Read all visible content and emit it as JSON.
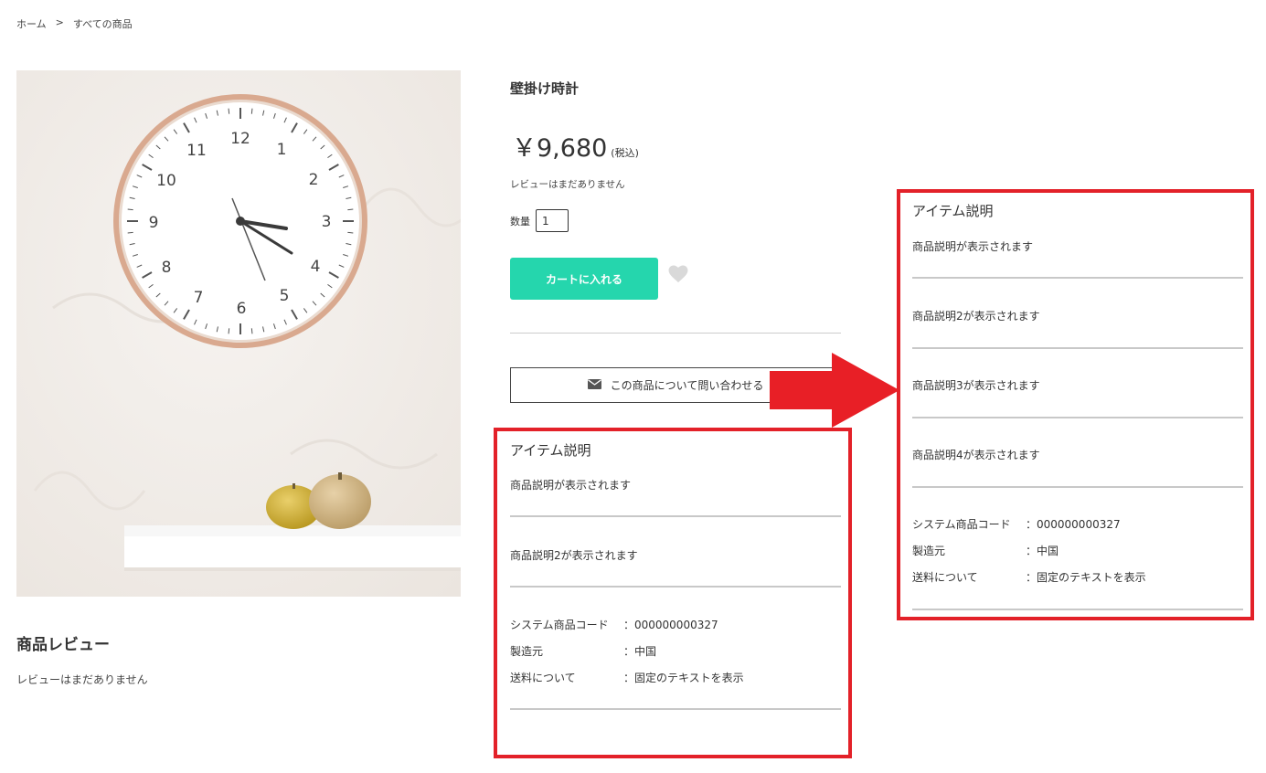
{
  "breadcrumb": {
    "home": "ホーム",
    "separator": ">",
    "current": "すべての商品"
  },
  "product": {
    "title": "壁掛け時計",
    "price": "￥9,680",
    "tax": "(税込)",
    "review_empty": "レビューはまだありません",
    "qty_label": "数量",
    "qty_value": "1",
    "cart_button": "カートに入れる",
    "inquiry_button": "この商品について問い合わせる"
  },
  "reviews": {
    "heading": "商品レビュー",
    "empty": "レビューはまだありません"
  },
  "panel_left": {
    "heading": "アイテム説明",
    "descriptions": [
      "商品説明が表示されます",
      "商品説明2が表示されます"
    ],
    "specs": [
      {
        "key": "システム商品コード",
        "value": "：000000000327"
      },
      {
        "key": "製造元",
        "value": "：中国"
      },
      {
        "key": "送料について",
        "value": "：固定のテキストを表示"
      }
    ]
  },
  "panel_right": {
    "heading": "アイテム説明",
    "descriptions": [
      "商品説明が表示されます",
      "商品説明2が表示されます",
      "商品説明3が表示されます",
      "商品説明4が表示されます"
    ],
    "specs": [
      {
        "key": "システム商品コード",
        "value": "：000000000327"
      },
      {
        "key": "製造元",
        "value": "：中国"
      },
      {
        "key": "送料について",
        "value": "：固定のテキストを表示"
      }
    ]
  },
  "colors": {
    "accent": "#25d6ad",
    "highlight": "#e32129",
    "arrow": "#e81f26"
  },
  "icons": {
    "inquiry": "envelope-icon",
    "favorite": "heart-icon",
    "annotation": "arrow-right-icon"
  }
}
